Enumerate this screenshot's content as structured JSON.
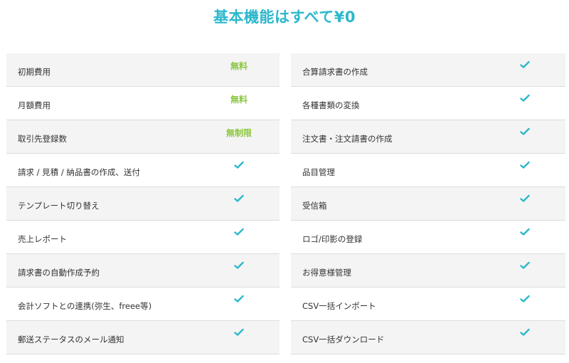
{
  "title": "基本機能はすべて¥0",
  "colors": {
    "accent": "#2bb8cc",
    "highlight": "#8cc63f"
  },
  "left_column": [
    {
      "label": "初期費用",
      "value": "無料",
      "type": "text"
    },
    {
      "label": "月額費用",
      "value": "無料",
      "type": "text"
    },
    {
      "label": "取引先登録数",
      "value": "無制限",
      "type": "text"
    },
    {
      "label": "請求 / 見積 / 納品書の作成、送付",
      "icon": "check-icon",
      "type": "check"
    },
    {
      "label": "テンプレート切り替え",
      "icon": "check-icon",
      "type": "check"
    },
    {
      "label": "売上レポート",
      "icon": "check-icon",
      "type": "check"
    },
    {
      "label": "請求書の自動作成予約",
      "icon": "check-icon",
      "type": "check"
    },
    {
      "label": "会計ソフトとの連携(弥生、freee等)",
      "icon": "check-icon",
      "type": "check"
    },
    {
      "label": "郵送ステータスのメール通知",
      "icon": "check-icon",
      "type": "check"
    }
  ],
  "right_column": [
    {
      "label": "合算請求書の作成",
      "icon": "check-icon",
      "type": "check"
    },
    {
      "label": "各種書類の変換",
      "icon": "check-icon",
      "type": "check"
    },
    {
      "label": "注文書・注文請書の作成",
      "icon": "check-icon",
      "type": "check"
    },
    {
      "label": "品目管理",
      "icon": "check-icon",
      "type": "check"
    },
    {
      "label": "受信箱",
      "icon": "check-icon",
      "type": "check"
    },
    {
      "label": "ロゴ/印影の登録",
      "icon": "check-icon",
      "type": "check"
    },
    {
      "label": "お得意様管理",
      "icon": "check-icon",
      "type": "check"
    },
    {
      "label": "CSV一括インポート",
      "icon": "check-icon",
      "type": "check"
    },
    {
      "label": "CSV一括ダウンロード",
      "icon": "check-icon",
      "type": "check"
    }
  ]
}
